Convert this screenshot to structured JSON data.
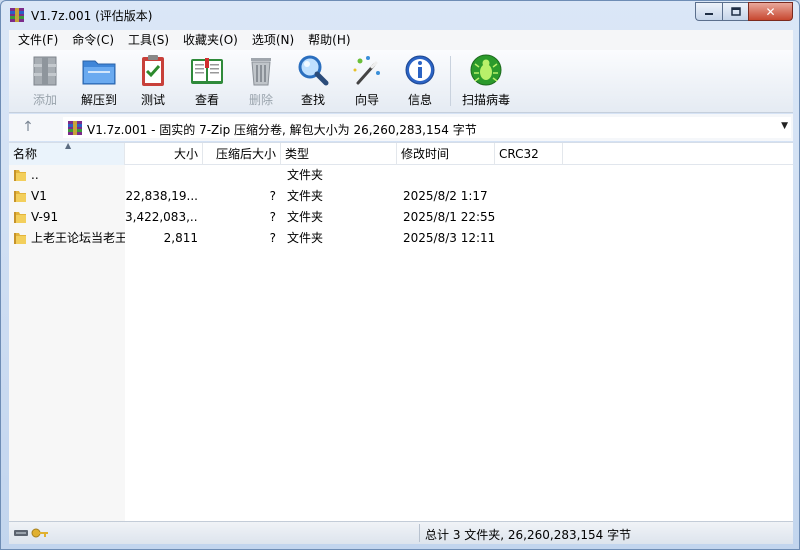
{
  "window": {
    "title": "V1.7z.001 (评估版本)",
    "minimize_icon": "minimize-icon",
    "maximize_icon": "maximize-icon",
    "close_icon": "close-icon",
    "close_glyph": "✕"
  },
  "menu": [
    {
      "label": "文件(F)"
    },
    {
      "label": "命令(C)"
    },
    {
      "label": "工具(S)"
    },
    {
      "label": "收藏夹(O)"
    },
    {
      "label": "选项(N)"
    },
    {
      "label": "帮助(H)"
    }
  ],
  "toolbar": {
    "add": "添加",
    "extract": "解压到",
    "test": "测试",
    "view": "查看",
    "delete": "删除",
    "find": "查找",
    "wizard": "向导",
    "info": "信息",
    "scan": "扫描病毒"
  },
  "address": {
    "path": "V1.7z.001 - 固实的 7-Zip 压缩分卷, 解包大小为 26,260,283,154 字节",
    "up_glyph": "↑",
    "dropdown_glyph": "▼"
  },
  "columns": {
    "name": "名称",
    "size": "大小",
    "packed": "压缩后大小",
    "type": "类型",
    "modified": "修改时间",
    "crc": "CRC32"
  },
  "files": [
    {
      "name": "..",
      "size": "",
      "packed": "",
      "type": "文件夹",
      "modified": ""
    },
    {
      "name": "V1",
      "size": "22,838,19...",
      "packed": "?",
      "type": "文件夹",
      "modified": "2025/8/2 1:17"
    },
    {
      "name": "V-91",
      "size": "3,422,083,...",
      "packed": "?",
      "type": "文件夹",
      "modified": "2025/8/1 22:55"
    },
    {
      "name": "上老王论坛当老王",
      "size": "2,811",
      "packed": "?",
      "type": "文件夹",
      "modified": "2025/8/3 12:11"
    }
  ],
  "status": {
    "summary": "总计 3 文件夹, 26,260,283,154 字节"
  },
  "colors": {
    "title_bar": "#c2d5ee",
    "close_button": "#c7472f",
    "list_background": "#ffffff"
  }
}
